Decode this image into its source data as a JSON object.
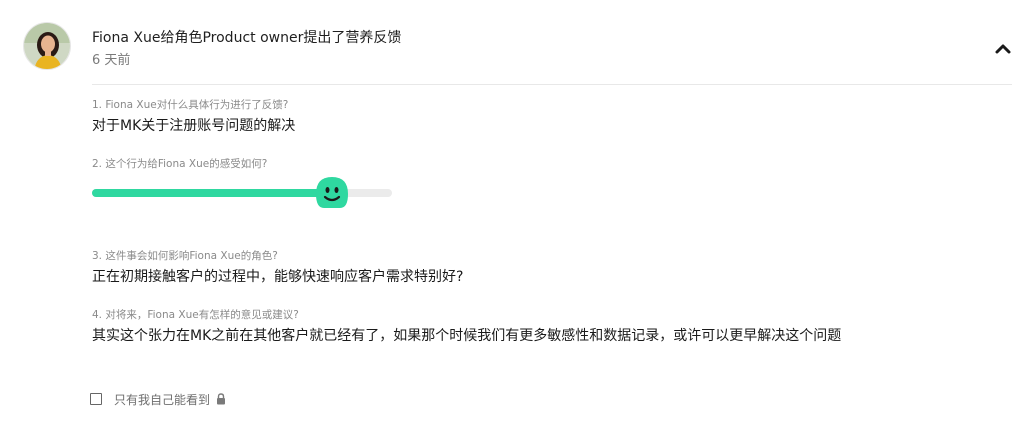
{
  "header": {
    "author_line": "Fiona Xue给角色Product owner提出了营养反馈",
    "time_ago": "6 天前"
  },
  "questions": [
    {
      "label": "1. Fiona Xue对什么具体行为进行了反馈?",
      "answer": "对于MK关于注册账号问题的解决"
    },
    {
      "label": "2. 这个行为给Fiona Xue的感受如何?",
      "rating_fraction": 0.8
    },
    {
      "label": "3. 这件事会如何影响Fiona Xue的角色?",
      "answer": "正在初期接触客户的过程中，能够快速响应客户需求特别好?"
    },
    {
      "label": "4. 对将来，Fiona Xue有怎样的意见或建议?",
      "answer": "其实这个张力在MK之前在其他客户就已经有了，如果那个时候我们有更多敏感性和数据记录，或许可以更早解决这个问题"
    }
  ],
  "privacy": {
    "label": "只有我自己能看到",
    "checked": false
  },
  "colors": {
    "slider_fill": "#2fd8a0",
    "slider_track": "#ebebeb",
    "thumb_face": "#2fd8a0"
  },
  "icons": {
    "collapse": "chevron-up-icon",
    "thumb": "smiley-face-icon",
    "lock": "lock-icon"
  }
}
